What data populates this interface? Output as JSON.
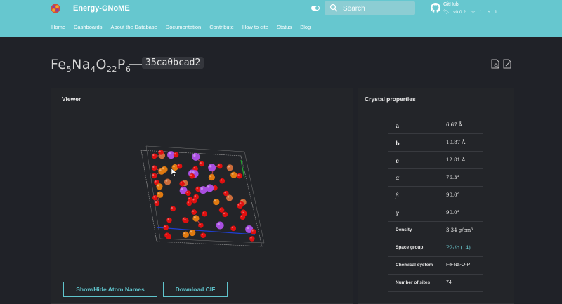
{
  "header": {
    "site_title": "Energy-GNoME",
    "search": {
      "placeholder": "Search"
    },
    "github": {
      "name": "GitHub",
      "version": "v0.0.2",
      "stars": "1",
      "forks": "1"
    },
    "nav": [
      "Home",
      "Dashboards",
      "About the Database",
      "Documentation",
      "Contribute",
      "How to cite",
      "Status",
      "Blog"
    ]
  },
  "page": {
    "formula_parts": {
      "fe": "Fe",
      "fe_n": "5",
      "na": "Na",
      "na_n": "4",
      "o": "O",
      "o_n": "22",
      "p": "P",
      "p_n": "6"
    },
    "separator": "—",
    "material_id": "35ca0bcad2"
  },
  "viewer": {
    "title": "Viewer",
    "toggle_button": "Show/Hide Atom Names",
    "download_button": "Download CIF",
    "atom_colors": {
      "O": "#e01010",
      "Fe": "#e07a10",
      "Na": "#a84ee0",
      "P": "#cc6c3a"
    }
  },
  "properties": {
    "title": "Crystal properties",
    "rows": [
      {
        "label": "a",
        "value": "6.67 Å"
      },
      {
        "label": "b",
        "value": "10.87 Å"
      },
      {
        "label": "c",
        "value": "12.81 Å"
      },
      {
        "label": "α",
        "value": "76.3°"
      },
      {
        "label": "β",
        "value": "90.0°"
      },
      {
        "label": "γ",
        "value": "90.0°"
      },
      {
        "label": "Density",
        "value": "3.34 g/cm³"
      },
      {
        "label": "Space group",
        "value": "P2₁/c (14)"
      },
      {
        "label": "Chemical system",
        "value": "Fe-Na-O-P"
      },
      {
        "label": "Number of sites",
        "value": "74"
      }
    ]
  }
}
